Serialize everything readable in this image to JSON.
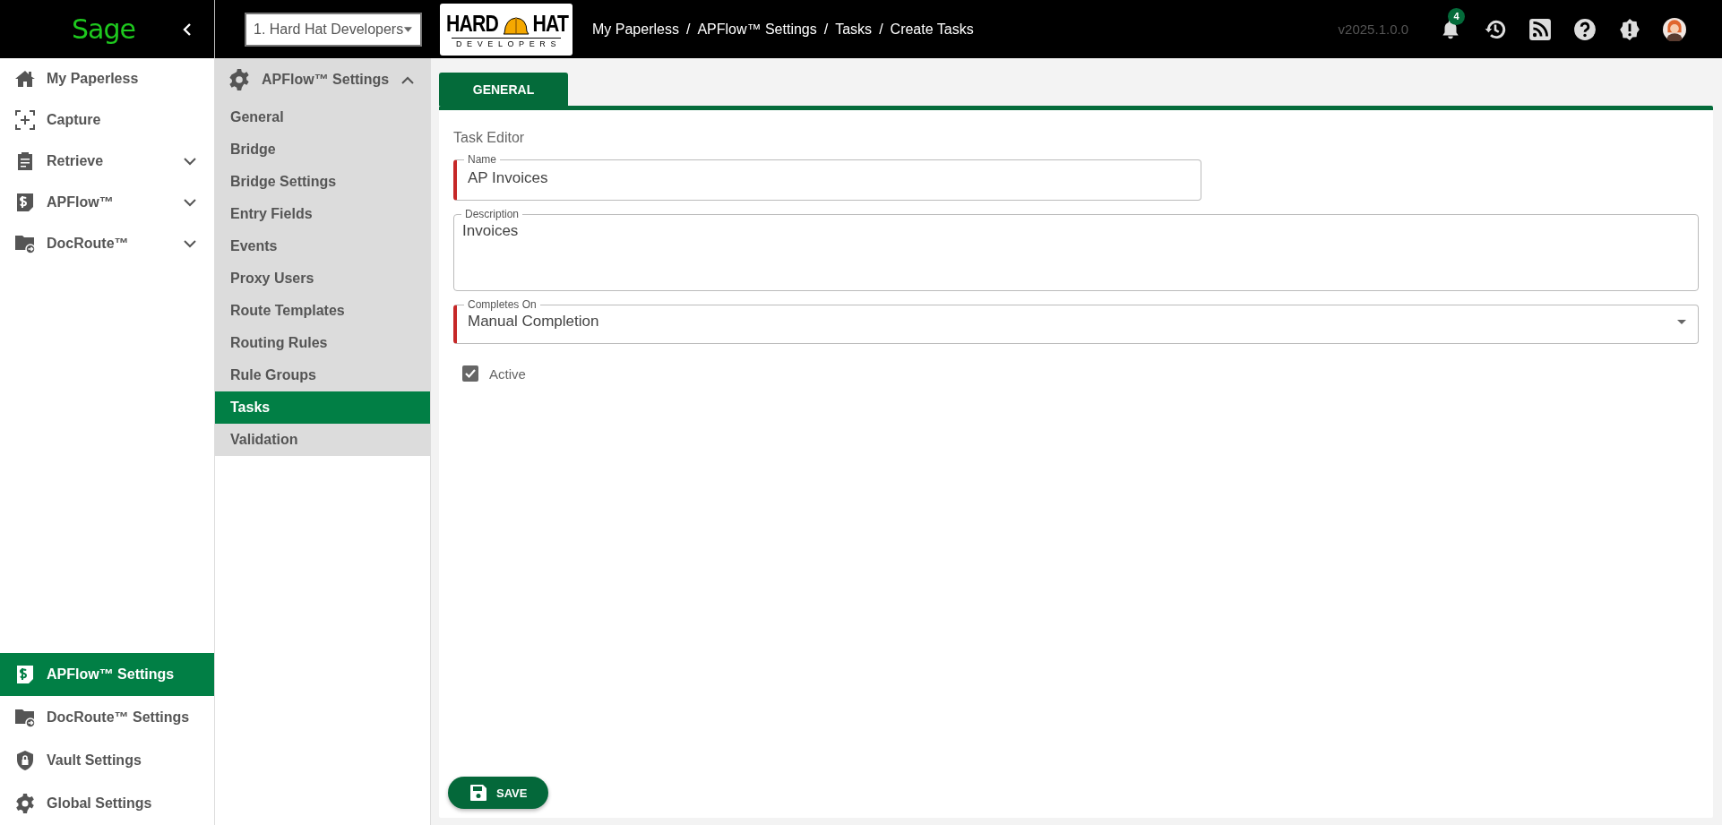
{
  "topbar": {
    "brand": "Sage",
    "company_select": "1. Hard Hat Developers",
    "logo": {
      "word_left": "HARD",
      "word_right": "HAT",
      "tagline": "DEVELOPERS"
    },
    "breadcrumbs": [
      "My Paperless",
      "APFlow™ Settings",
      "Tasks",
      "Create Tasks"
    ],
    "breadcrumb_separator": "/",
    "version": "v2025.1.0.0",
    "notification_count": "4"
  },
  "sidebar": {
    "items": [
      {
        "label": "My Paperless",
        "expandable": false,
        "selected": false
      },
      {
        "label": "Capture",
        "expandable": false,
        "selected": false
      },
      {
        "label": "Retrieve",
        "expandable": true,
        "selected": false
      },
      {
        "label": "APFlow™",
        "expandable": true,
        "selected": false
      },
      {
        "label": "DocRoute™",
        "expandable": true,
        "selected": false
      }
    ],
    "bottom_items": [
      {
        "label": "APFlow™ Settings",
        "selected": true
      },
      {
        "label": "DocRoute™ Settings",
        "selected": false
      },
      {
        "label": "Vault Settings",
        "selected": false
      },
      {
        "label": "Global Settings",
        "selected": false
      }
    ]
  },
  "settings_menu": {
    "title": "APFlow™ Settings",
    "expanded": true,
    "items": [
      {
        "label": "General",
        "selected": false
      },
      {
        "label": "Bridge",
        "selected": false
      },
      {
        "label": "Bridge Settings",
        "selected": false
      },
      {
        "label": "Entry Fields",
        "selected": false
      },
      {
        "label": "Events",
        "selected": false
      },
      {
        "label": "Proxy Users",
        "selected": false
      },
      {
        "label": "Route Templates",
        "selected": false
      },
      {
        "label": "Routing Rules",
        "selected": false
      },
      {
        "label": "Rule Groups",
        "selected": false
      },
      {
        "label": "Tasks",
        "selected": true
      },
      {
        "label": "Validation",
        "selected": false
      }
    ]
  },
  "tabs": [
    {
      "label": "GENERAL",
      "selected": true
    }
  ],
  "form": {
    "title": "Task Editor",
    "fields": [
      {
        "kind": "text",
        "label": "Name",
        "value": "AP Invoices",
        "required": true
      },
      {
        "kind": "textarea",
        "label": "Description",
        "value": "Invoices",
        "required": false
      },
      {
        "kind": "select",
        "label": "Completes On",
        "value": "Manual Completion",
        "required": true
      }
    ],
    "checkbox": {
      "label": "Active",
      "checked": true
    },
    "save_button": "SAVE"
  }
}
